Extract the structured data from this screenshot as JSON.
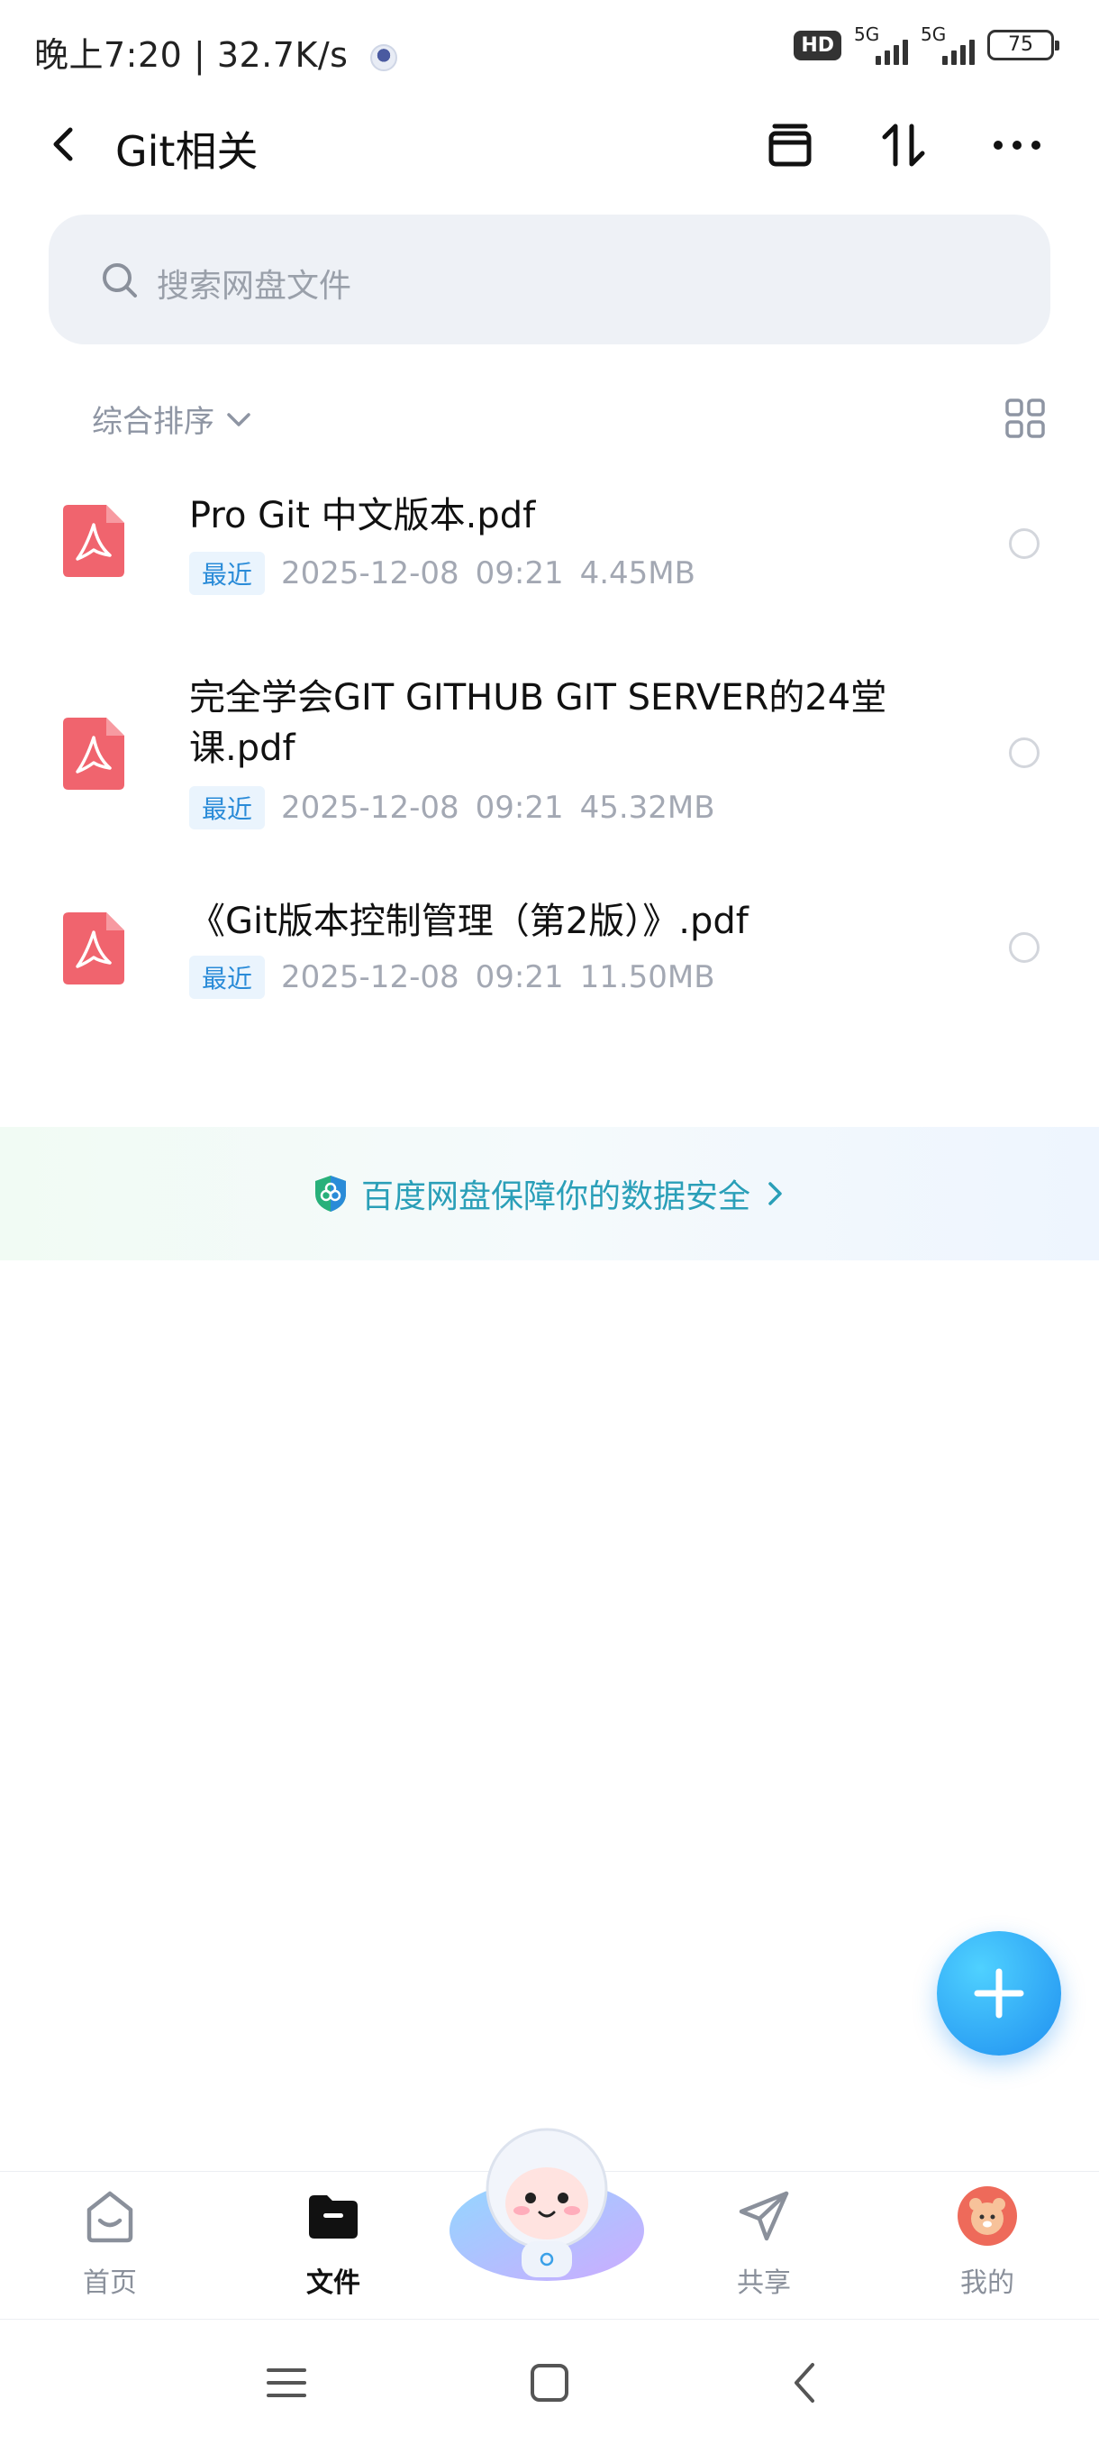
{
  "status_bar": {
    "time": "晚上7:20",
    "speed": "32.7K/s",
    "hd": "HD",
    "network_1": "5G",
    "network_2": "5G",
    "battery": "75"
  },
  "header": {
    "title": "Git相关"
  },
  "search": {
    "placeholder": "搜索网盘文件"
  },
  "sort": {
    "label": "综合排序"
  },
  "files": [
    {
      "name": "Pro Git 中文版本.pdf",
      "tag": "最近",
      "date": "2025-12-08",
      "time": "09:21",
      "size": "4.45MB"
    },
    {
      "name": "完全学会GIT GITHUB GIT SERVER的24堂课.pdf",
      "tag": "最近",
      "date": "2025-12-08",
      "time": "09:21",
      "size": "45.32MB"
    },
    {
      "name": "《Git版本控制管理（第2版）》.pdf",
      "tag": "最近",
      "date": "2025-12-08",
      "time": "09:21",
      "size": "11.50MB"
    }
  ],
  "safety_banner": {
    "text": "百度网盘保障你的数据安全"
  },
  "bottom_nav": [
    {
      "label": "首页",
      "icon": "home-icon",
      "active": false
    },
    {
      "label": "文件",
      "icon": "folder-icon",
      "active": true
    },
    {
      "label": "共享",
      "icon": "share-icon",
      "active": false
    },
    {
      "label": "我的",
      "icon": "profile-avatar-icon",
      "active": false
    }
  ],
  "colors": {
    "accent": "#2a8bd8",
    "pdf_red": "#f0646e",
    "fab_blue": "#1f8ff0",
    "safety_teal": "#2a9fb8"
  }
}
